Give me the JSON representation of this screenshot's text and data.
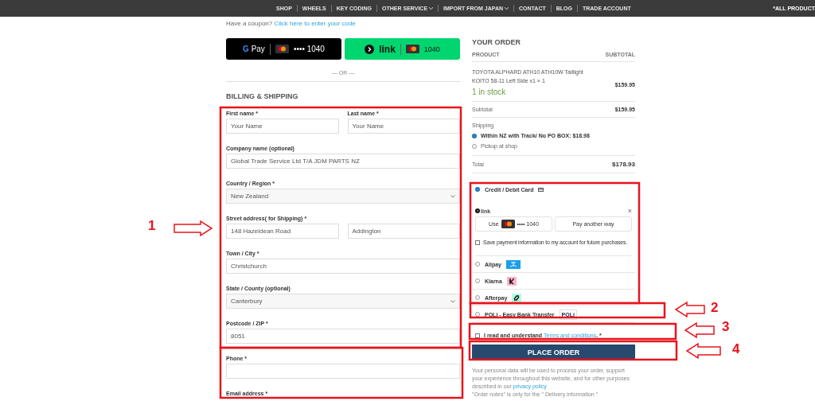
{
  "nav": {
    "items": [
      {
        "label": "SHOP",
        "dropdown": false
      },
      {
        "label": "WHEELS",
        "dropdown": false
      },
      {
        "label": "KEY CODING",
        "dropdown": false
      },
      {
        "label": "OTHER SERVICE",
        "dropdown": true
      },
      {
        "label": "IMPORT FROM JAPAN",
        "dropdown": true
      },
      {
        "label": "CONTACT",
        "dropdown": false
      },
      {
        "label": "BLOG",
        "dropdown": false
      },
      {
        "label": "TRADE ACCOUNT",
        "dropdown": false
      }
    ],
    "right_item": "*ALL PRODUCT"
  },
  "coupon": {
    "text": "Have a coupon?",
    "link": "Click here to enter your code"
  },
  "express": {
    "gpay": {
      "g": "G",
      "label": "Pay",
      "card": "•••• 1040"
    },
    "link": {
      "label": "link",
      "card": "1040"
    },
    "separator": "— OR —"
  },
  "billing": {
    "title": "BILLING & SHIPPING",
    "rows": [
      {
        "kind": "split",
        "fields": [
          {
            "label": "First name *",
            "value": "Your Name"
          },
          {
            "label": "Last name *",
            "value": "Your Name"
          }
        ]
      },
      {
        "kind": "text",
        "label": "Company name (optional)",
        "values": [
          "Global Trade Service Ltd T/A JDM PARTS NZ"
        ]
      },
      {
        "kind": "select",
        "label": "Country / Region *",
        "value": "New Zealand"
      },
      {
        "kind": "text",
        "label": "Street address( for Shipping) *",
        "values": [
          "148 Hazeldean Road",
          "Addington"
        ]
      },
      {
        "kind": "text",
        "label": "Town / City *",
        "values": [
          "Christchurch"
        ]
      },
      {
        "kind": "select",
        "label": "State / County (optional)",
        "value": "Canterbury"
      },
      {
        "kind": "text",
        "label": "Postcode / ZIP *",
        "values": [
          "8051"
        ]
      },
      {
        "kind": "text",
        "label": "Phone *"
      },
      {
        "kind": "label",
        "label": "Email address *"
      }
    ]
  },
  "order": {
    "title": "YOUR ORDER",
    "columns": [
      "PRODUCT",
      "SUBTOTAL"
    ],
    "item": {
      "name": "TOYOTA ALPHARD ATH10 ATH10W Taillight KOITO 58-11 Left Side x1",
      "qty": "× 1",
      "stock": "1 in stock",
      "price": "$159.95"
    },
    "subtotal": {
      "label": "Subtotal",
      "value": "$159.95"
    },
    "shipping": {
      "label": "Shipping",
      "options": [
        {
          "label": "Within NZ with Track/ No PO BOX:",
          "price": "$18.98",
          "selected": true
        },
        {
          "label": "Pickup at shop",
          "selected": false
        }
      ]
    },
    "total": {
      "label": "Total",
      "value": "$178.93"
    }
  },
  "payment": {
    "methods": [
      {
        "kind": "card",
        "label": "Credit / Debit Card",
        "selected": true
      },
      {
        "kind": "alipay",
        "label": "Alipay",
        "selected": false
      },
      {
        "kind": "klarna",
        "label": "Klarna",
        "selected": false
      },
      {
        "kind": "afterpay",
        "label": "Afterpay",
        "selected": false
      },
      {
        "kind": "poli",
        "label": "POLi - Easy Bank Transfer",
        "badge": "POLi",
        "selected": false
      }
    ],
    "link": {
      "label": "link",
      "close": "×",
      "use": "Use",
      "card": "•••• 1040",
      "other": "Pay another way"
    },
    "save": {
      "label": "Save payment information to my account for future purchases.",
      "checked": false
    }
  },
  "terms": {
    "text": "I read and understand",
    "link": "Terms and conditions",
    "suffix": ". *",
    "checked": false
  },
  "place_order": "PLACE ORDER",
  "privacy": {
    "text": "Your personal data will be used to process your order, support your experience throughout this website, and for other purposes described in our",
    "link": "privacy policy"
  },
  "notes": "\"Order notes\" is only for the \" Delivery information \"",
  "annotations": [
    "1",
    "2",
    "3",
    "4"
  ]
}
